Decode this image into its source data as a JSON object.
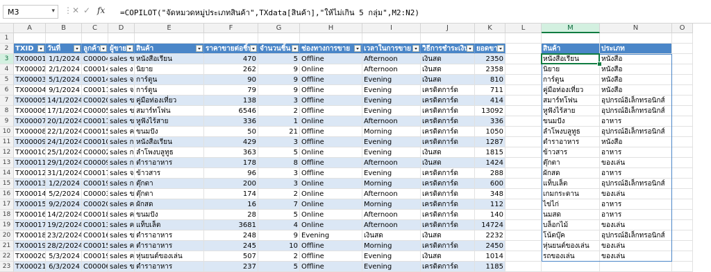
{
  "formula_bar": {
    "name_box": "M3",
    "cancel_glyph": "✕",
    "enter_glyph": "✓",
    "fx_label": "fx",
    "formula": "=COPILOT(\"จัดหมวดหมู่ประเภทสินค้า\",TXdata[สินค้า],\"ให้ไม่เกิน 5 กลุ่ม\",M2:N2)"
  },
  "columns": [
    "A",
    "B",
    "C",
    "D",
    "E",
    "F",
    "G",
    "H",
    "I",
    "J",
    "K",
    "L",
    "M",
    "N",
    "O"
  ],
  "rows": [
    "1",
    "2",
    "3",
    "4",
    "5",
    "6",
    "7",
    "8",
    "9",
    "10",
    "11",
    "12",
    "13",
    "14",
    "15",
    "16",
    "17",
    "18",
    "19",
    "20",
    "21",
    "22",
    "23"
  ],
  "table": {
    "headers": [
      "TXID",
      "วันที่",
      "ลูกค้า",
      "ผู้ขาย",
      "สินค้า",
      "ราคาขายต่อชิ้น",
      "จำนวนชิ้น",
      "ช่องทางการขาย",
      "เวลาในการขาย",
      "วิธีการชำระเงิน",
      "ยอดขาย"
    ],
    "rows": [
      [
        "TX00001",
        "1/1/2024",
        "C00004",
        "sales ข",
        "หนังสือเรียน",
        "470",
        "5",
        "Offline",
        "Afternoon",
        "เงินสด",
        "2350"
      ],
      [
        "TX00002",
        "2/1/2024",
        "C00014",
        "sales ง",
        "นิยาย",
        "262",
        "9",
        "Online",
        "Afternoon",
        "เงินสด",
        "2358"
      ],
      [
        "TX00003",
        "5/1/2024",
        "C00014",
        "sales จ",
        "การ์ตูน",
        "90",
        "9",
        "Offline",
        "Evening",
        "เงินสด",
        "810"
      ],
      [
        "TX00004",
        "9/1/2024",
        "C00011",
        "sales จ",
        "การ์ตูน",
        "79",
        "9",
        "Offline",
        "Evening",
        "เครดิตการ์ด",
        "711"
      ],
      [
        "TX00005",
        "14/1/2024",
        "C00020",
        "sales ข",
        "คู่มือท่องเที่ยว",
        "138",
        "3",
        "Offline",
        "Evening",
        "เครดิตการ์ด",
        "414"
      ],
      [
        "TX00006",
        "17/1/2024",
        "C00005",
        "sales ข",
        "สมาร์ทโฟน",
        "6546",
        "2",
        "Offline",
        "Evening",
        "เครดิตการ์ด",
        "13092"
      ],
      [
        "TX00007",
        "20/1/2024",
        "C00011",
        "sales ข",
        "หูฟังไร้สาย",
        "336",
        "1",
        "Online",
        "Afternoon",
        "เครดิตการ์ด",
        "336"
      ],
      [
        "TX00008",
        "22/1/2024",
        "C00015",
        "sales ค",
        "ขนมปัง",
        "50",
        "21",
        "Offline",
        "Morning",
        "เครดิตการ์ด",
        "1050"
      ],
      [
        "TX00009",
        "24/1/2024",
        "C00010",
        "sales ก",
        "หนังสือเรียน",
        "429",
        "3",
        "Offline",
        "Evening",
        "เครดิตการ์ด",
        "1287"
      ],
      [
        "TX00010",
        "25/1/2024",
        "C00002",
        "sales ก",
        "ลำโพงบลูทูธ",
        "363",
        "5",
        "Online",
        "Evening",
        "เงินสด",
        "1815"
      ],
      [
        "TX00011",
        "29/1/2024",
        "C00009",
        "sales ก",
        "ตำราอาหาร",
        "178",
        "8",
        "Offline",
        "Afternoon",
        "เงินสด",
        "1424"
      ],
      [
        "TX00012",
        "31/1/2024",
        "C00017",
        "sales จ",
        "ข้าวสาร",
        "96",
        "3",
        "Offline",
        "Evening",
        "เครดิตการ์ด",
        "288"
      ],
      [
        "TX00013",
        "1/2/2024",
        "C00019",
        "sales ก",
        "ตุ๊กตา",
        "200",
        "3",
        "Online",
        "Morning",
        "เครดิตการ์ด",
        "600"
      ],
      [
        "TX00014",
        "5/2/2024",
        "C00003",
        "sales ข",
        "ตุ๊กตา",
        "174",
        "2",
        "Online",
        "Afternoon",
        "เครดิตการ์ด",
        "348"
      ],
      [
        "TX00015",
        "9/2/2024",
        "C00020",
        "sales ค",
        "ผักสด",
        "16",
        "7",
        "Online",
        "Morning",
        "เครดิตการ์ด",
        "112"
      ],
      [
        "TX00016",
        "14/2/2024",
        "C00018",
        "sales ค",
        "ขนมปัง",
        "28",
        "5",
        "Online",
        "Afternoon",
        "เครดิตการ์ด",
        "140"
      ],
      [
        "TX00017",
        "19/2/2024",
        "C00013",
        "sales ค",
        "แท็บเล็ต",
        "3681",
        "4",
        "Online",
        "Afternoon",
        "เครดิตการ์ด",
        "14724"
      ],
      [
        "TX00018",
        "23/2/2024",
        "C00016",
        "sales ข",
        "ตำราอาหาร",
        "248",
        "9",
        "Evening",
        "เงินสด",
        "เงินสด",
        "2232"
      ],
      [
        "TX00019",
        "28/2/2024",
        "C00015",
        "sales ค",
        "ตำราอาหาร",
        "245",
        "10",
        "Offline",
        "Morning",
        "เครดิตการ์ด",
        "2450"
      ],
      [
        "TX00020",
        "5/3/2024",
        "C00019",
        "sales ค",
        "หุ่นยนต์ของเล่น",
        "507",
        "2",
        "Offline",
        "Evening",
        "เงินสด",
        "1014"
      ],
      [
        "TX00021",
        "6/3/2024",
        "C00006",
        "sales ข",
        "ตำราอาหาร",
        "237",
        "5",
        "Offline",
        "Evening",
        "เครดิตการ์ด",
        "1185"
      ]
    ]
  },
  "result": {
    "headers": [
      "สินค้า",
      "ประเภท"
    ],
    "rows": [
      [
        "หนังสือเรียน",
        "หนังสือ"
      ],
      [
        "นิยาย",
        "หนังสือ"
      ],
      [
        "การ์ตูน",
        "หนังสือ"
      ],
      [
        "คู่มือท่องเที่ยว",
        "หนังสือ"
      ],
      [
        "สมาร์ทโฟน",
        "อุปกรณ์อิเล็กทรอนิกส์"
      ],
      [
        "หูฟังไร้สาย",
        "อุปกรณ์อิเล็กทรอนิกส์"
      ],
      [
        "ขนมปัง",
        "อาหาร"
      ],
      [
        "ลำโพงบลูทูธ",
        "อุปกรณ์อิเล็กทรอนิกส์"
      ],
      [
        "ตำราอาหาร",
        "หนังสือ"
      ],
      [
        "ข้าวสาร",
        "อาหาร"
      ],
      [
        "ตุ๊กตา",
        "ของเล่น"
      ],
      [
        "ผักสด",
        "อาหาร"
      ],
      [
        "แท็บเล็ต",
        "อุปกรณ์อิเล็กทรอนิกส์"
      ],
      [
        "เกมกระดาน",
        "ของเล่น"
      ],
      [
        "ไข่ไก่",
        "อาหาร"
      ],
      [
        "นมสด",
        "อาหาร"
      ],
      [
        "บล็อกไม้",
        "ของเล่น"
      ],
      [
        "โน้ตบุ๊ค",
        "อุปกรณ์อิเล็กทรอนิกส์"
      ],
      [
        "หุ่นยนต์ของเล่น",
        "ของเล่น"
      ],
      [
        "รถของเล่น",
        "ของเล่น"
      ]
    ]
  },
  "colors": {
    "header_blue": "#4a86c8",
    "band_blue": "#dbe7f5",
    "select_green": "#107c41"
  }
}
